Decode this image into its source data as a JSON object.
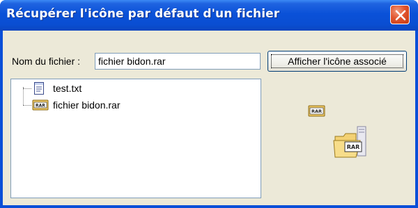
{
  "window": {
    "title": "Récupérer l'icône par défaut d'un fichier",
    "close_icon": "close-icon"
  },
  "form": {
    "filename_label": "Nom du fichier :",
    "filename_value": "fichier bidon.rar",
    "show_icon_button": "Afficher l'icône associé"
  },
  "tree": {
    "items": [
      {
        "label": "test.txt",
        "icon": "text-file-icon"
      },
      {
        "label": "fichier bidon.rar",
        "icon": "rar-archive-icon"
      }
    ]
  },
  "preview": {
    "small_icon": "rar-archive-icon",
    "large_icon": "rar-folder-archive-icon"
  },
  "colors": {
    "titlebar": "#0a51d8",
    "client_background": "#ece9d8",
    "close_button": "#e1542d"
  }
}
